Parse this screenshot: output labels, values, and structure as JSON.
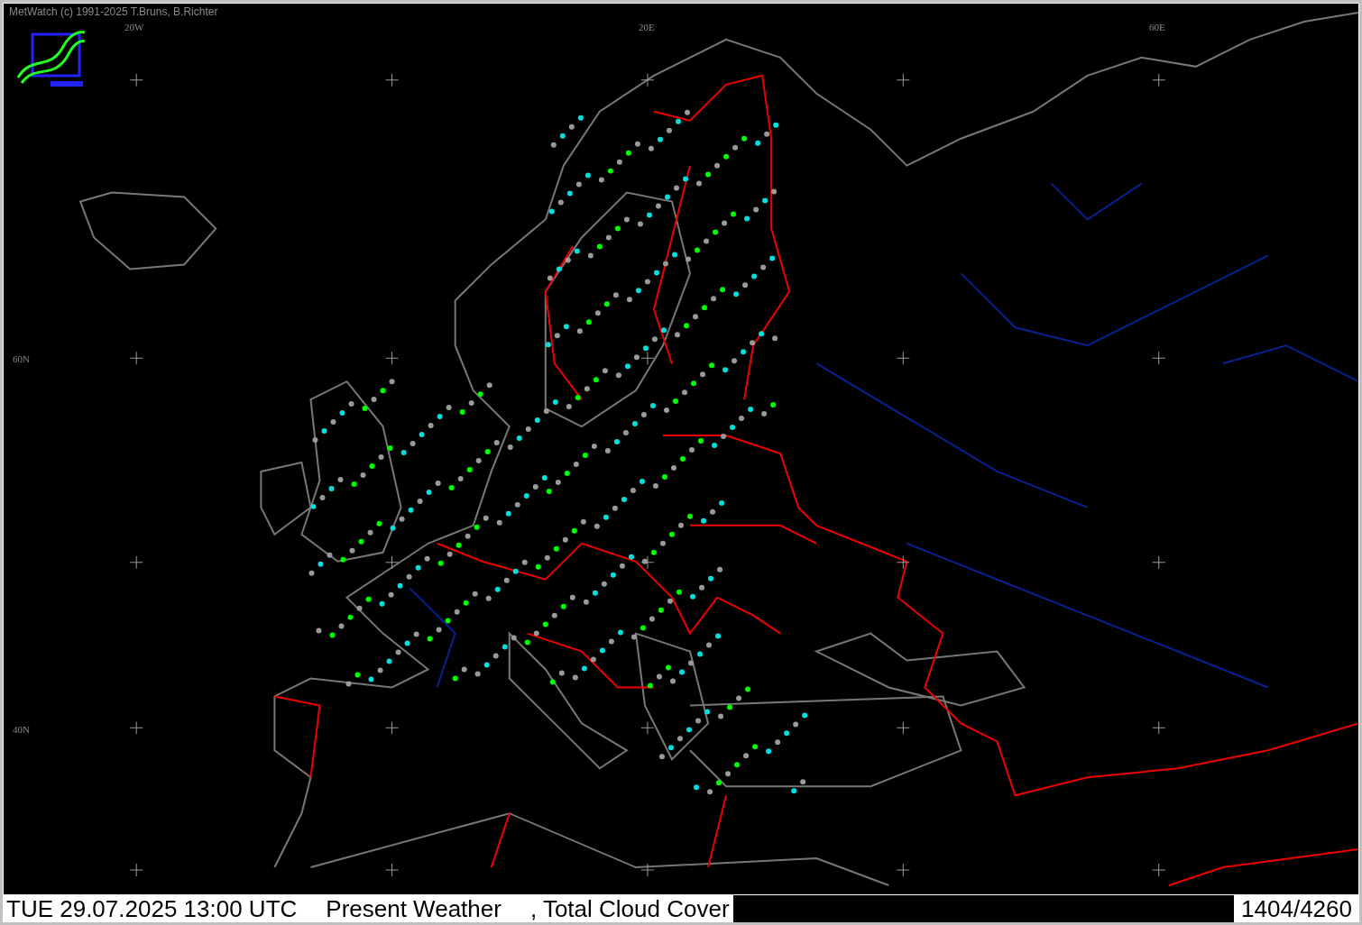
{
  "window": {
    "title": "MetWatch  (c) 1991-2025 T.Bruns, B.Richter"
  },
  "map": {
    "grid_labels": [
      "20W",
      "20E",
      "60E",
      "60N",
      "40N"
    ]
  },
  "status_bar": {
    "datetime": "TUE 29.07.2025 13:00 UTC",
    "fields": [
      "Present Weather",
      ", Total Cloud Cover"
    ],
    "count": "1404/4260"
  }
}
